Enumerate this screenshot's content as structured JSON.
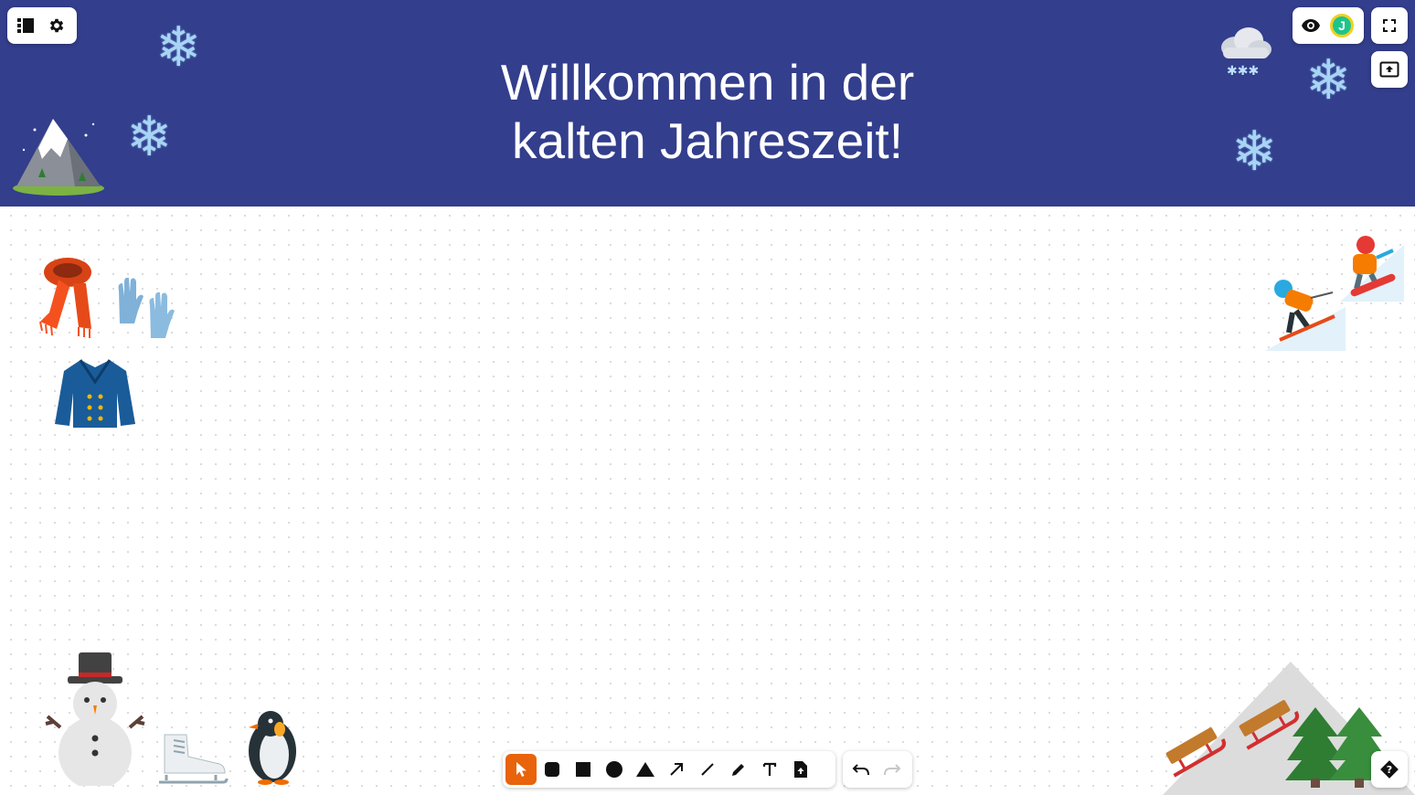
{
  "banner": {
    "title_line1": "Willkommen in der",
    "title_line2": "kalten Jahreszeit!",
    "background": "#333e8c"
  },
  "top_left_menu": {
    "icons": [
      "list-icon",
      "gear-icon"
    ]
  },
  "top_right": {
    "icons": [
      "eye-icon",
      "avatar",
      "fullscreen-icon",
      "share-screen-icon"
    ],
    "avatar_initial": "J"
  },
  "stickers": {
    "banner": [
      "snowflake",
      "snowflake",
      "snowflake",
      "snowflake",
      "snowflake",
      "mountain",
      "cloud-with-snow"
    ],
    "canvas": [
      "scarf",
      "gloves",
      "coat",
      "skier",
      "snowboarder",
      "snowman",
      "ice-skate",
      "penguin",
      "sled",
      "sled",
      "evergreen-tree",
      "evergreen-tree"
    ]
  },
  "toolbar": {
    "tools": [
      "select-tool",
      "rounded-rect-tool",
      "rect-tool",
      "circle-tool",
      "triangle-tool",
      "arrow-tool",
      "line-tool",
      "pencil-tool",
      "text-tool",
      "upload-tool"
    ],
    "active_tool": "select-tool",
    "active_color": "#e8630a",
    "history": [
      "undo",
      "redo"
    ]
  },
  "help": {
    "icon": "help-icon"
  }
}
